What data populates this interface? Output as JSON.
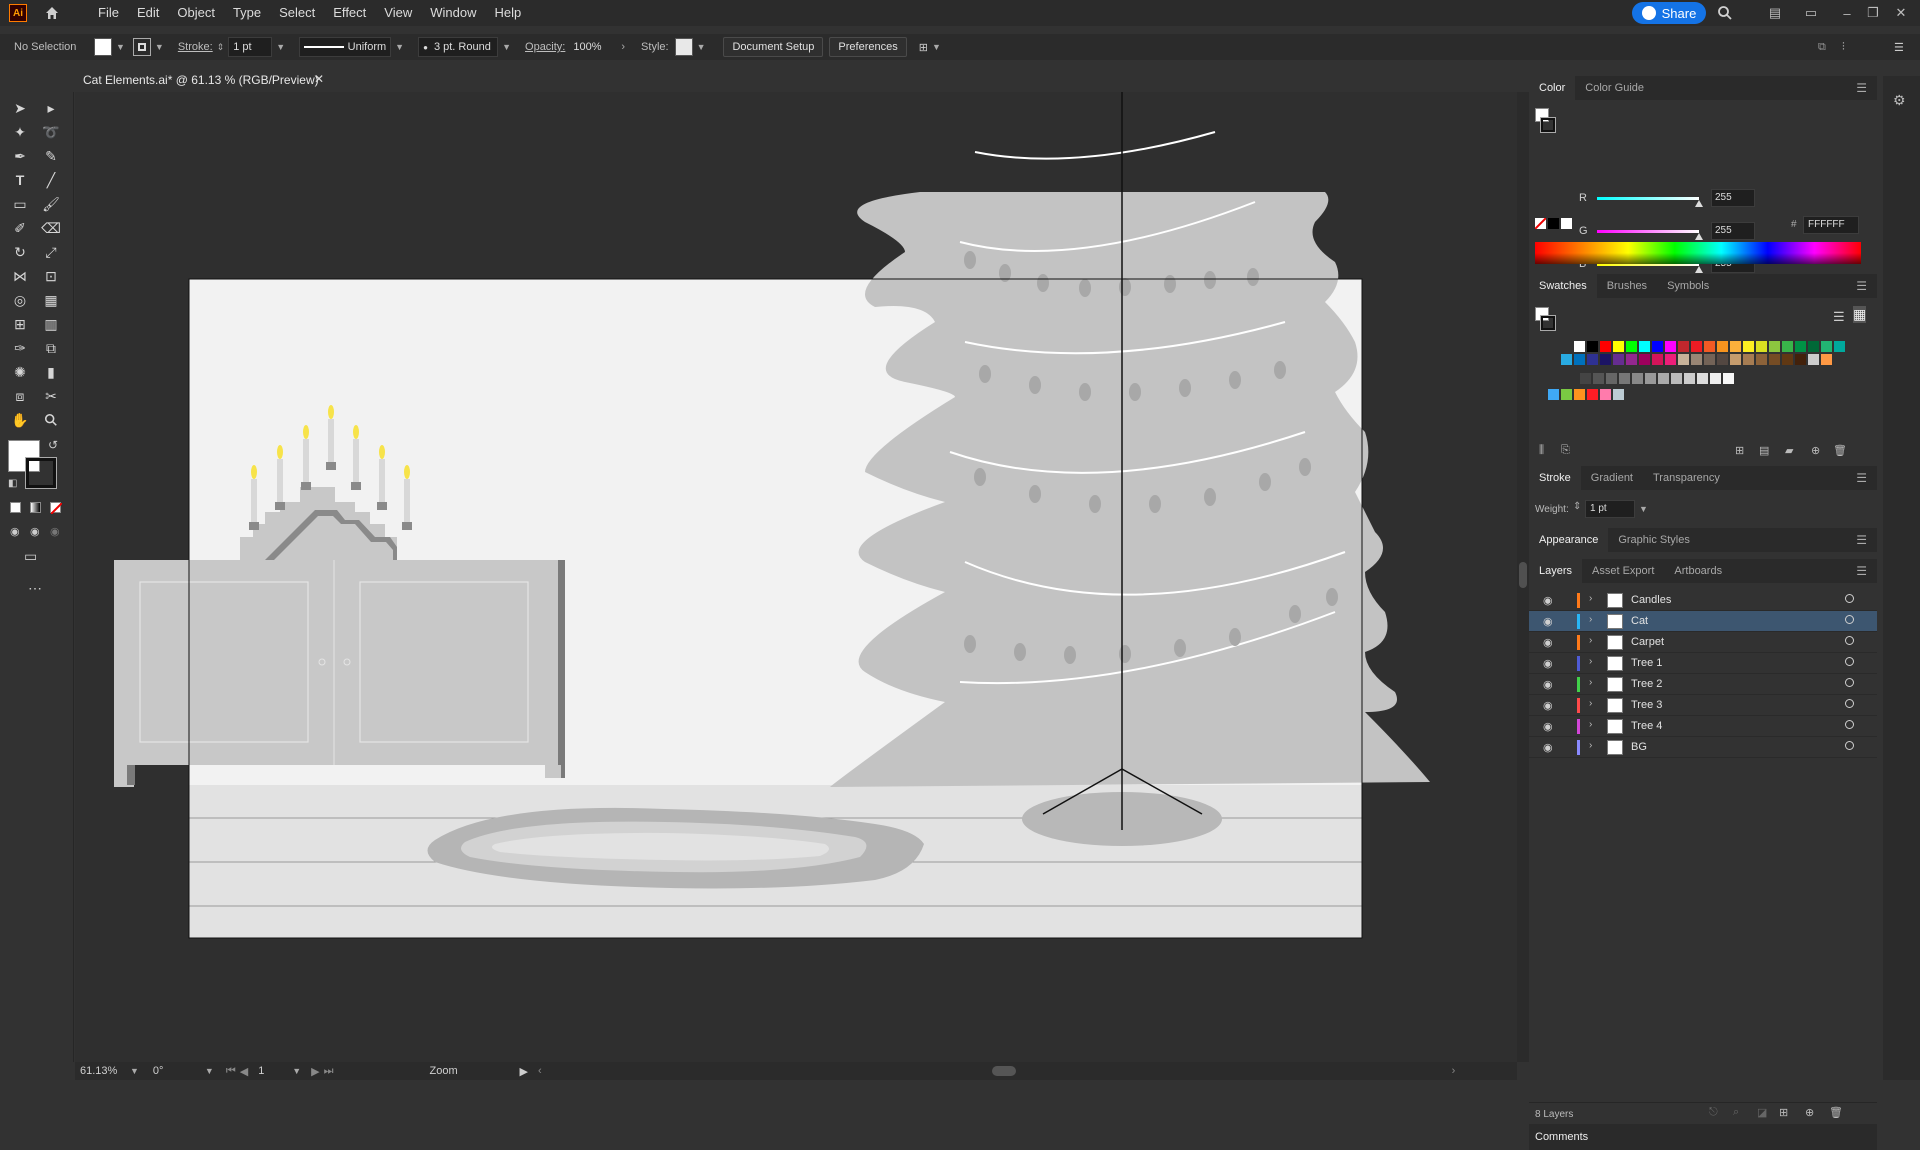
{
  "app": {
    "logo": "Ai"
  },
  "menu": [
    "File",
    "Edit",
    "Object",
    "Type",
    "Select",
    "Effect",
    "View",
    "Window",
    "Help"
  ],
  "share": {
    "label": "Share"
  },
  "control": {
    "selection": "No Selection",
    "stroke_label": "Stroke:",
    "stroke_weight": "1 pt",
    "profile": "Uniform",
    "brush": "3 pt. Round",
    "opacity_label": "Opacity:",
    "opacity": "100%",
    "style_label": "Style:",
    "doc_setup": "Document Setup",
    "preferences": "Preferences"
  },
  "document": {
    "tab_title": "Cat Elements.ai* @ 61.13 % (RGB/Preview)"
  },
  "status": {
    "zoom": "61.13%",
    "rotation": "0°",
    "artboard": "1",
    "tool": "Zoom"
  },
  "color_panel": {
    "tabs": [
      "Color",
      "Color Guide"
    ],
    "r": "255",
    "g": "255",
    "b": "255",
    "hex": "FFFFFF",
    "labels": {
      "r": "R",
      "g": "G",
      "b": "B",
      "hash": "#"
    }
  },
  "swatches_panel": {
    "tabs": [
      "Swatches",
      "Brushes",
      "Symbols"
    ]
  },
  "stroke_panel": {
    "tabs": [
      "Stroke",
      "Gradient",
      "Transparency"
    ],
    "weight_label": "Weight:",
    "weight": "1 pt"
  },
  "appearance_panel": {
    "tabs": [
      "Appearance",
      "Graphic Styles"
    ]
  },
  "layers_panel": {
    "tabs": [
      "Layers",
      "Asset Export",
      "Artboards"
    ],
    "layers": [
      {
        "name": "Candles",
        "color": "#ff7a1a"
      },
      {
        "name": "Cat",
        "color": "#29b6f6"
      },
      {
        "name": "Carpet",
        "color": "#ff7a1a"
      },
      {
        "name": "Tree 1",
        "color": "#4f5bd5"
      },
      {
        "name": "Tree 2",
        "color": "#41d14a"
      },
      {
        "name": "Tree 3",
        "color": "#ff4a4a"
      },
      {
        "name": "Tree 4",
        "color": "#d346d8"
      },
      {
        "name": "BG",
        "color": "#8a8aff"
      }
    ],
    "count": "8 Layers"
  },
  "comments": {
    "label": "Comments"
  }
}
